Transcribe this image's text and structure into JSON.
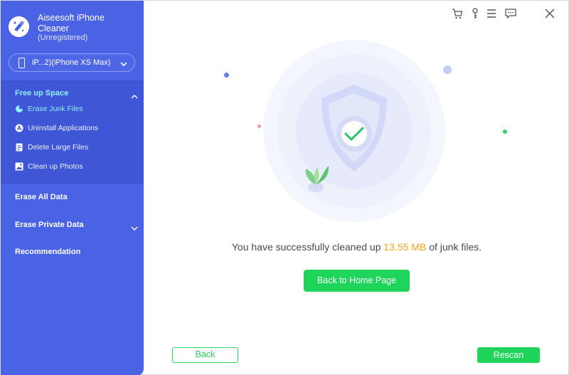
{
  "app": {
    "name": "Aiseesoft iPhone Cleaner",
    "status": "(Unregistered)"
  },
  "device": {
    "label": "iP...2)(iPhone XS Max)"
  },
  "sidebar": {
    "groups": [
      {
        "title": "Free up Space",
        "expanded": true,
        "items": [
          {
            "label": "Erase Junk Files",
            "icon": "pie-chart-icon",
            "active": true
          },
          {
            "label": "Uninstall Applications",
            "icon": "app-store-icon",
            "active": false
          },
          {
            "label": "Delete Large Files",
            "icon": "file-icon",
            "active": false
          },
          {
            "label": "Clean up Photos",
            "icon": "photo-icon",
            "active": false
          }
        ]
      },
      {
        "title": "Erase All Data"
      },
      {
        "title": "Erase Private Data"
      },
      {
        "title": "Recommendation"
      }
    ]
  },
  "toolbar": {
    "icons": [
      "cart-icon",
      "key-icon",
      "menu-icon",
      "feedback-icon",
      "close-icon"
    ]
  },
  "result": {
    "prefix": "You have successfully cleaned up",
    "amount": "13.55 MB",
    "suffix": "of junk files."
  },
  "buttons": {
    "home": "Back to Home Page",
    "back": "Back",
    "rescan": "Rescan"
  },
  "colors": {
    "sidebar": "#4a62e4",
    "accent_green": "#1ed45a",
    "amount_orange": "#f2a41c",
    "active_item": "#8ff0ff"
  }
}
